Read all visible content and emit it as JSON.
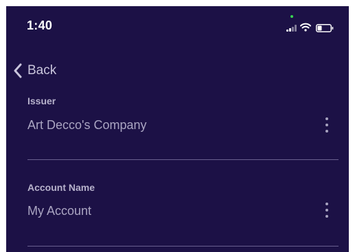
{
  "status_bar": {
    "time": "1:40",
    "icons": [
      "cellular-signal-icon",
      "wifi-icon",
      "battery-icon"
    ]
  },
  "nav": {
    "back_label": "Back"
  },
  "fields": [
    {
      "label": "Issuer",
      "value": "Art Decco's Company"
    },
    {
      "label": "Account Name",
      "value": "My Account"
    }
  ],
  "colors": {
    "background": "#1c1146",
    "divider": "#6a6190",
    "privacy_indicator": "#39d353"
  }
}
